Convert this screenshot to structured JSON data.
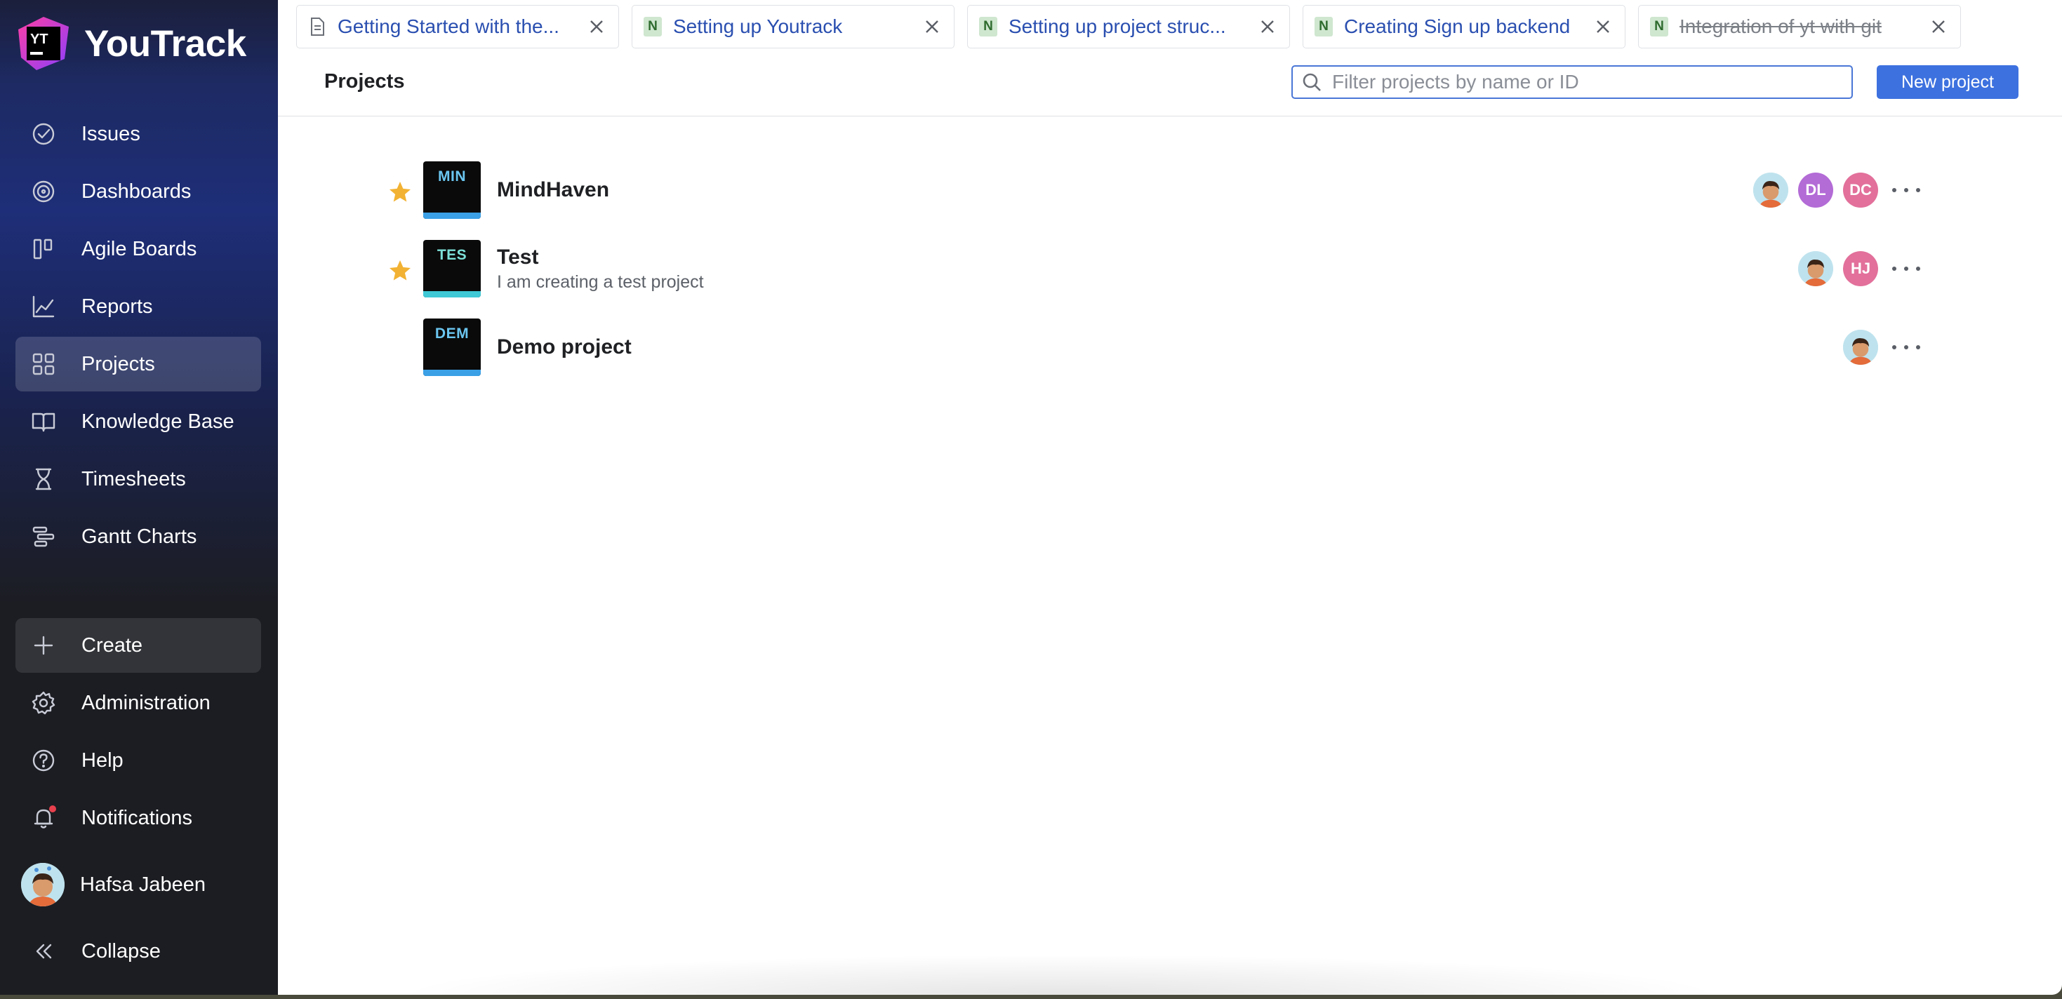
{
  "app": {
    "name": "YouTrack"
  },
  "sidebar": {
    "items": [
      {
        "label": "Issues",
        "icon": "issues-check-icon"
      },
      {
        "label": "Dashboards",
        "icon": "dashboard-icon"
      },
      {
        "label": "Agile Boards",
        "icon": "agile-board-icon"
      },
      {
        "label": "Reports",
        "icon": "reports-chart-icon"
      },
      {
        "label": "Projects",
        "icon": "projects-grid-icon",
        "active": true
      },
      {
        "label": "Knowledge Base",
        "icon": "book-icon"
      },
      {
        "label": "Timesheets",
        "icon": "hourglass-icon"
      },
      {
        "label": "Gantt Charts",
        "icon": "gantt-icon"
      }
    ],
    "bottom": {
      "create": "Create",
      "administration": "Administration",
      "help": "Help",
      "notifications": "Notifications",
      "user": "Hafsa Jabeen",
      "collapse": "Collapse"
    }
  },
  "tabs": [
    {
      "label": "Getting Started with the...",
      "icon": "document-icon"
    },
    {
      "label": "Setting up Youtrack",
      "icon": "N"
    },
    {
      "label": "Setting up project struc...",
      "icon": "N"
    },
    {
      "label": "Creating Sign up backend",
      "icon": "N"
    },
    {
      "label": "Integration of yt with git",
      "icon": "N",
      "resolved": true
    }
  ],
  "header": {
    "title": "Projects",
    "search_placeholder": "Filter projects by name or ID",
    "new_project": "New project"
  },
  "projects": [
    {
      "code": "MIN",
      "name": "MindHaven",
      "description": "",
      "starred": true,
      "members": [
        "photo",
        "DL",
        "DC"
      ]
    },
    {
      "code": "TES",
      "name": "Test",
      "description": "I am creating a test project",
      "starred": true,
      "members": [
        "photo",
        "HJ"
      ]
    },
    {
      "code": "DEM",
      "name": "Demo project",
      "description": "",
      "starred": false,
      "members": [
        "photo"
      ]
    }
  ],
  "colors": {
    "accent": "#3d71df",
    "star": "#f2b233",
    "avatar_DL": "#b36bd6",
    "avatar_DC": "#e2709a",
    "avatar_HJ": "#e2709a"
  }
}
